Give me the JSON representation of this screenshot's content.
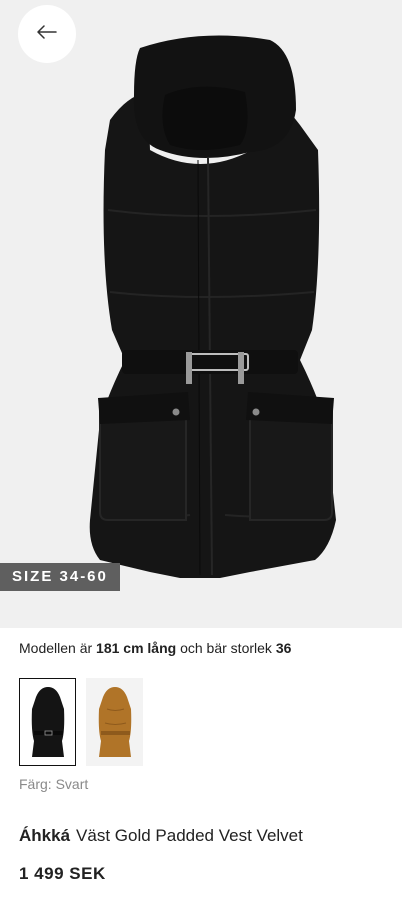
{
  "product_image": {
    "alt": "Black padded vest",
    "size_badge": "SIZE 34-60"
  },
  "model_info": {
    "prefix": "Modellen är ",
    "height": "181 cm lång",
    "middle": " och bär storlek ",
    "size": "36"
  },
  "swatches": [
    {
      "color_name": "Svart",
      "hex": "#141414",
      "selected": true
    },
    {
      "color_name": "Camel",
      "hex": "#b07428",
      "selected": false
    }
  ],
  "color_label": "Färg: Svart",
  "product": {
    "brand": "Áhkká",
    "name": "Väst Gold Padded Vest Velvet",
    "price": "1 499 SEK"
  },
  "icons": {
    "back": "arrow-left-icon"
  }
}
